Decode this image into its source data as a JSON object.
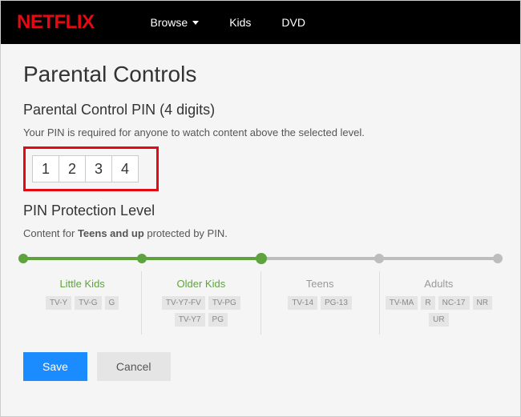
{
  "brand": "NETFLIX",
  "nav": {
    "browse": "Browse",
    "kids": "Kids",
    "dvd": "DVD"
  },
  "page": {
    "title": "Parental Controls",
    "pin_heading": "Parental Control PIN (4 digits)",
    "pin_helper": "Your PIN is required for anyone to watch content above the selected level.",
    "pin": {
      "d1": "1",
      "d2": "2",
      "d3": "3",
      "d4": "4"
    },
    "level_heading": "PIN Protection Level",
    "protection_prefix": "Content for ",
    "protection_level": "Teens and up",
    "protection_suffix": " protected by PIN."
  },
  "levels": [
    {
      "label": "Little Kids",
      "ratings": [
        "TV-Y",
        "TV-G",
        "G"
      ],
      "active": true
    },
    {
      "label": "Older Kids",
      "ratings": [
        "TV-Y7-FV",
        "TV-PG",
        "TV-Y7",
        "PG"
      ],
      "active": true
    },
    {
      "label": "Teens",
      "ratings": [
        "TV-14",
        "PG-13"
      ],
      "active": false
    },
    {
      "label": "Adults",
      "ratings": [
        "TV-MA",
        "R",
        "NC-17",
        "NR",
        "UR"
      ],
      "active": false
    }
  ],
  "slider": {
    "selected_index": 2,
    "total_stops": 5
  },
  "actions": {
    "save": "Save",
    "cancel": "Cancel"
  }
}
